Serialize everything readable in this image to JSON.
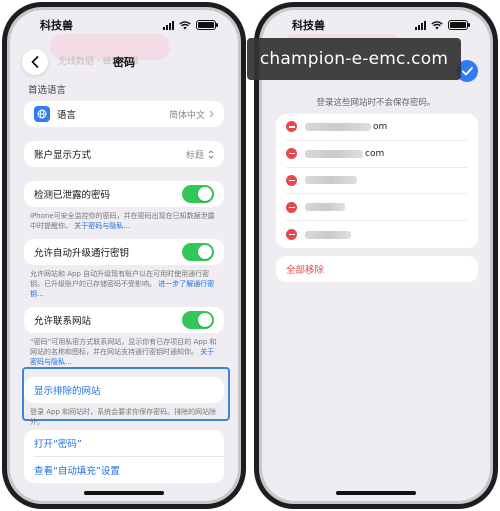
{
  "left": {
    "status": {
      "carrier": "科技兽"
    },
    "nav": {
      "title": "密码",
      "ghost": "无线数据 · 蜂窝网络"
    },
    "language": {
      "section_label": "首选语言",
      "row_label": "语言",
      "row_value": "简体中文"
    },
    "account_display": {
      "label": "账户显示方式",
      "value": "标题"
    },
    "breached": {
      "label": "检测已泄露的密码",
      "toggle_on": true,
      "footnote": "iPhone可安全监控你的密码，并在密码出现在已知数据泄露中时提醒你。",
      "footnote_link": "关于密码与隐私…"
    },
    "passkey_upgrade": {
      "label": "允许自动升级通行密钥",
      "toggle_on": true,
      "footnote": "允许网站和 App 自动升级现有账户以在可用时使用通行密钥。已升级账户的已存储密码不受影响。",
      "footnote_link": "进一步了解通行密钥…"
    },
    "contact_sites": {
      "label": "允许联系网站",
      "toggle_on": true,
      "footnote": "“密码”可用私密方式联系网站，显示你有已存项目的 App 和网站的名称和图标，并在网站支持通行密钥时通知你。",
      "footnote_link": "关于密码与隐私…"
    },
    "excluded_sites": {
      "label": "显示排除的网站",
      "footnote": "登录 App 和网站时，系统会要求你保存密码。排除的网站除外。"
    },
    "links": {
      "open_passwords": "打开“密码”",
      "autofill_settings": "查看“自动填充”设置"
    }
  },
  "right": {
    "status": {
      "carrier": "科技兽"
    },
    "section_label": "登录这些网站时不会保存密码。",
    "sites": [
      {
        "suffix": "om"
      },
      {
        "suffix": "com"
      },
      {
        "suffix": ""
      },
      {
        "suffix": ""
      },
      {
        "suffix": ""
      }
    ],
    "remove_all": "全部移除"
  },
  "watermark": "champion-e-emc.com",
  "colors": {
    "accent": "#2f7cf6",
    "toggle": "#34c759",
    "destructive": "#e5484d",
    "highlight": "#3b86d6"
  },
  "icons": [
    "globe-icon",
    "chevron-right-icon",
    "chevron-updown-icon",
    "back-chevron-icon",
    "checkmark-icon",
    "minus-circle-icon",
    "signal-icon",
    "wifi-icon",
    "battery-icon"
  ]
}
